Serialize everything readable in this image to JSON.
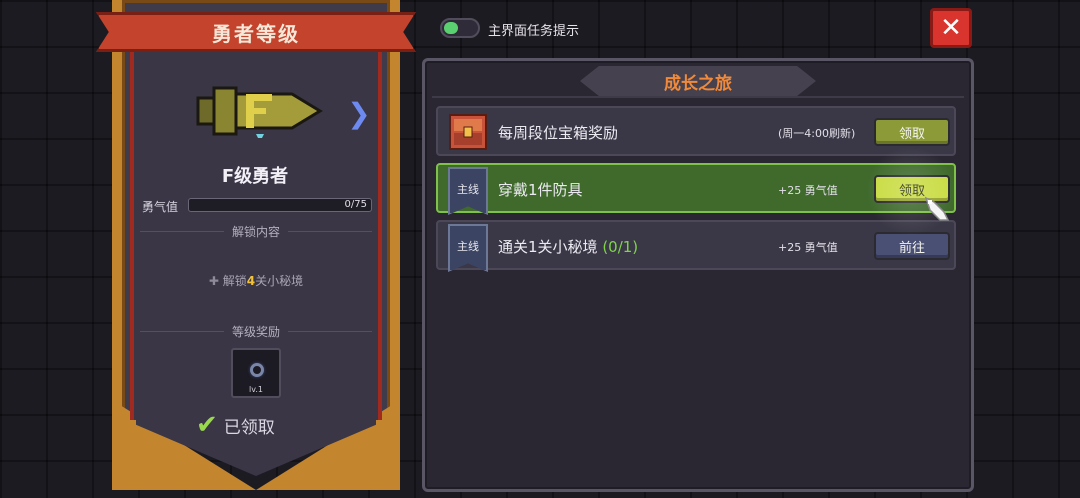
{
  "rank_panel": {
    "title": "勇者等级",
    "rank_name": "F级勇者",
    "courage_label": "勇气值",
    "courage_value_text": "0/75",
    "courage_progress": 0,
    "unlock_section_title": "解锁内容",
    "unlock_prefix": "解锁",
    "unlock_count": "4",
    "unlock_suffix": "关小秘境",
    "reward_section_title": "等级奖励",
    "reward_level": "lv.1",
    "claimed_label": "已领取"
  },
  "topbar": {
    "toggle_label": "主界面任务提示",
    "toggle_on": true,
    "close_symbol": "✕"
  },
  "journey": {
    "title": "成长之旅",
    "tasks": [
      {
        "badge": "",
        "icon": "treasure-chest-icon",
        "title": "每周段位宝箱奖励",
        "progress": "",
        "reward": "(周一4:00刷新)",
        "button": "领取",
        "state": "claim"
      },
      {
        "badge": "主线",
        "icon": "",
        "title": "穿戴1件防具",
        "progress": "",
        "reward": "+25 勇气值",
        "button": "领取",
        "state": "claim-highlight"
      },
      {
        "badge": "主线",
        "icon": "",
        "title": "通关1关小秘境 ",
        "progress": "(0/1)",
        "reward": "+25 勇气值",
        "button": "前往",
        "state": "go"
      }
    ]
  },
  "icons": {
    "rank_emblem": "rank-f-emblem-icon",
    "next_arrow": "chevron-right-icon",
    "reward_item": "ring-icon",
    "checkmark": "check-icon",
    "pointer": "hand-pointer-icon"
  },
  "colors": {
    "accent_orange": "#f08a3a",
    "active_green": "#3f6a2c",
    "close_red": "#d9352e",
    "banner_red": "#c4432d",
    "banner_gold": "#c3862e"
  }
}
